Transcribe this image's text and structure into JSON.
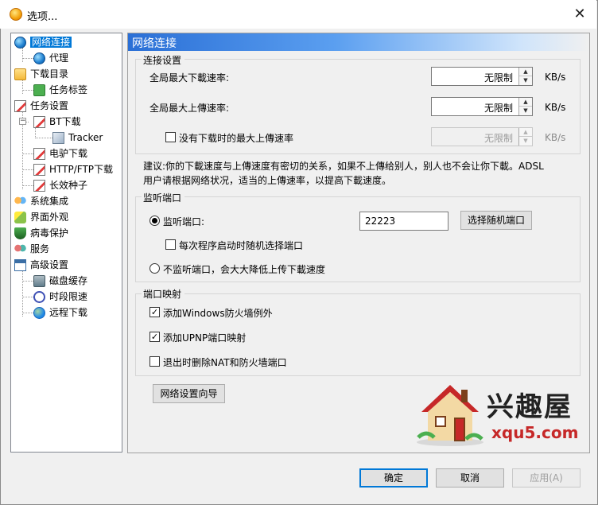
{
  "window": {
    "title": "选项..."
  },
  "tree": {
    "items": [
      {
        "label": "网络连接",
        "icon": "globe-icon"
      },
      {
        "label": "代理",
        "icon": "globe-icon"
      },
      {
        "label": "下载目录",
        "icon": "folder-icon"
      },
      {
        "label": "任务标签",
        "icon": "tag-icon"
      },
      {
        "label": "任务设置",
        "icon": "task-icon"
      },
      {
        "label": "BT下载",
        "icon": "task-icon"
      },
      {
        "label": "Tracker",
        "icon": "cube-icon"
      },
      {
        "label": "电驴下载",
        "icon": "task-icon"
      },
      {
        "label": "HTTP/FTP下载",
        "icon": "task-icon"
      },
      {
        "label": "长效种子",
        "icon": "task-icon"
      },
      {
        "label": "系统集成",
        "icon": "people-icon"
      },
      {
        "label": "界面外观",
        "icon": "brush-icon"
      },
      {
        "label": "病毒保护",
        "icon": "shield-icon"
      },
      {
        "label": "服务",
        "icon": "service-icon"
      },
      {
        "label": "高级设置",
        "icon": "settings-window-icon"
      },
      {
        "label": "磁盘缓存",
        "icon": "disk-icon"
      },
      {
        "label": "时段限速",
        "icon": "clock-icon"
      },
      {
        "label": "远程下载",
        "icon": "remote-globe-icon"
      }
    ],
    "selected": "网络连接"
  },
  "panel": {
    "header": "网络连接",
    "connection": {
      "title": "连接设置",
      "max_download_label": "全局最大下載速率:",
      "max_download_value": "无限制",
      "max_upload_label": "全局最大上傳速率:",
      "max_upload_value": "无限制",
      "idle_upload_label": "没有下载时的最大上傳速率",
      "idle_upload_value": "无限制",
      "unit": "KB/s",
      "advice_line1": "建议:你的下載速度与上傳速度有密切的关系，如果不上傳给别人，别人也不会让你下載。ADSL",
      "advice_line2": "用户请根据网络状况，适当的上傳速率，以提高下載速度。"
    },
    "listen": {
      "title": "监听端口",
      "listen_radio_label": "监听端口:",
      "port_value": "22223",
      "random_port_button": "选择随机端口",
      "random_each_start_label": "每次程序启动时随机选择端口",
      "no_listen_radio_label": "不监听端口，会大大降低上传下載速度"
    },
    "mapping": {
      "title": "端口映射",
      "firewall_label": "添加Windows防火墙例外",
      "firewall_checked": true,
      "upnp_label": "添加UPNP端口映射",
      "upnp_checked": true,
      "cleanup_label": "退出时删除NAT和防火墙端口",
      "cleanup_checked": false
    },
    "wizard_button": "网络设置向导"
  },
  "footer": {
    "ok": "确定",
    "cancel": "取消",
    "apply": "应用(A)"
  },
  "watermark": {
    "brand": "兴趣屋",
    "url": "xqu5.com"
  }
}
